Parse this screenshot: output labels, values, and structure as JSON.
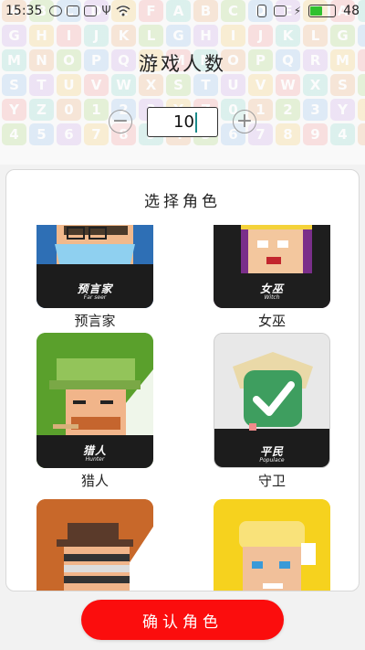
{
  "status_bar": {
    "time": "15:35",
    "battery_level": "48",
    "battery_fraction": 0.48,
    "icons_left": [
      "message-icon",
      "image-icon",
      "mail-icon",
      "usb-icon",
      "wifi-icon"
    ],
    "icons_right": [
      "vibrate-icon",
      "cast-icon",
      "charging-icon",
      "battery-icon"
    ]
  },
  "background_tiles": {
    "rows": [
      [
        "A",
        "B",
        "C",
        "D",
        "E",
        "F",
        "A",
        "B",
        "C",
        "D",
        "E",
        "F",
        "A",
        "B"
      ],
      [
        "G",
        "H",
        "I",
        "J",
        "K",
        "L",
        "G",
        "H",
        "I",
        "J",
        "K",
        "L",
        "G",
        "H"
      ],
      [
        "M",
        "N",
        "O",
        "P",
        "Q",
        "R",
        "M",
        "N",
        "O",
        "P",
        "Q",
        "R",
        "M",
        "N"
      ],
      [
        "S",
        "T",
        "U",
        "V",
        "W",
        "X",
        "S",
        "T",
        "U",
        "V",
        "W",
        "X",
        "S",
        "T"
      ],
      [
        "Y",
        "Z",
        "0",
        "1",
        "2",
        "3",
        "Y",
        "Z",
        "0",
        "1",
        "2",
        "3",
        "Y",
        "Z"
      ],
      [
        "4",
        "5",
        "6",
        "7",
        "8",
        "9",
        "4",
        "5",
        "6",
        "7",
        "8",
        "9",
        "4",
        "5"
      ]
    ],
    "colors": [
      "#e7a26a",
      "#9fce6b",
      "#88b6e8",
      "#c39be0",
      "#f0c25a",
      "#ef8a8a",
      "#7fd0c3"
    ]
  },
  "header": {
    "title": "游戏人数",
    "player_count": "10",
    "minus_icon": "minus-circle-icon",
    "plus_icon": "plus-circle-icon"
  },
  "role_panel": {
    "title": "选择角色",
    "roles": [
      {
        "name": "预言家",
        "badge_cn": "预言家",
        "badge_en": "Far seer",
        "bg": "#3a7bbf"
      },
      {
        "name": "女巫",
        "badge_cn": "女巫",
        "badge_en": "Witch",
        "bg": "#7a2f7a"
      },
      {
        "name": "猎人",
        "badge_cn": "猎人",
        "badge_en": "Hunter",
        "bg": "#5aa02c"
      },
      {
        "name": "守卫",
        "badge_cn": "平民",
        "badge_en": "Populace",
        "bg": "#e6e6e6"
      },
      {
        "name": "",
        "badge_cn": "",
        "badge_en": "",
        "bg": "#c8682a"
      },
      {
        "name": "",
        "badge_cn": "",
        "badge_en": "",
        "bg": "#f6d21e"
      }
    ]
  },
  "footer": {
    "confirm_label": "确认角色",
    "accent": "#fb0d0d"
  }
}
